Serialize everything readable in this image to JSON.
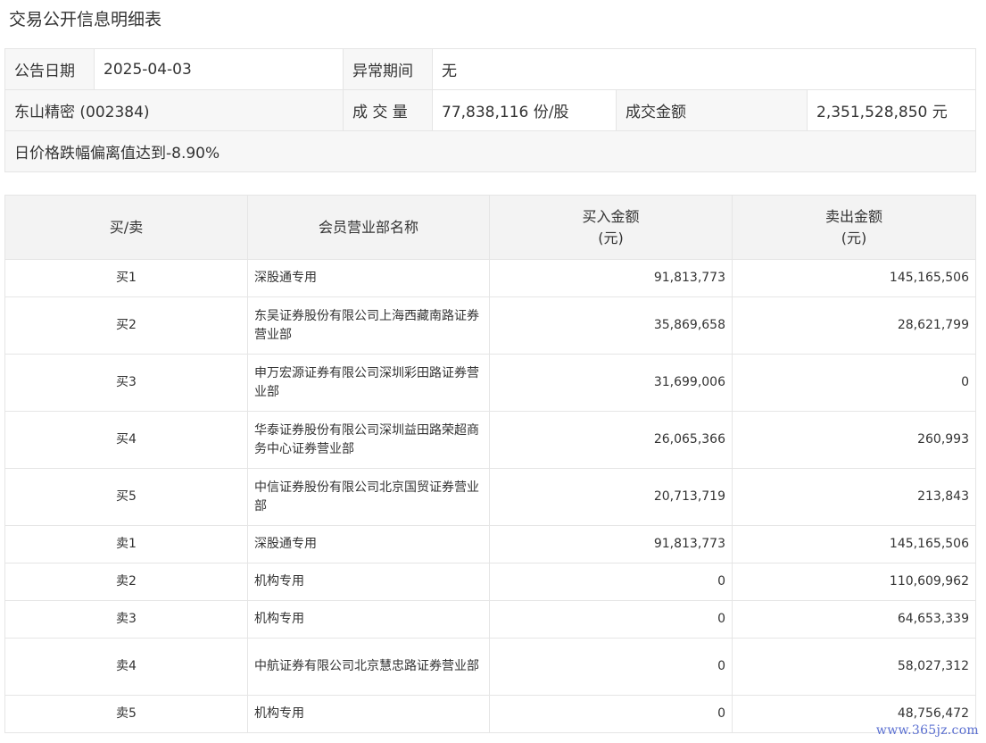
{
  "title": "交易公开信息明细表",
  "info": {
    "date_label": "公告日期",
    "date_value": "2025-04-03",
    "period_label": "异常期间",
    "period_value": "无",
    "stock": "东山精密 (002384)",
    "volume_label": "成 交 量",
    "volume_value": "77,838,116 份/股",
    "amount_label": "成交金额",
    "amount_value": "2,351,528,850 元",
    "note": "日价格跌幅偏离值达到-8.90%"
  },
  "table": {
    "headers": {
      "side": "买/卖",
      "broker": "会员营业部名称",
      "buy_line1": "买入金额",
      "buy_line2": "(元)",
      "sell_line1": "卖出金额",
      "sell_line2": "(元)"
    },
    "rows": [
      {
        "side": "买1",
        "broker": "深股通专用",
        "buy": "91,813,773",
        "sell": "145,165,506"
      },
      {
        "side": "买2",
        "broker": "东吴证券股份有限公司上海西藏南路证券营业部",
        "buy": "35,869,658",
        "sell": "28,621,799"
      },
      {
        "side": "买3",
        "broker": "申万宏源证券有限公司深圳彩田路证券营业部",
        "buy": "31,699,006",
        "sell": "0"
      },
      {
        "side": "买4",
        "broker": "华泰证券股份有限公司深圳益田路荣超商务中心证券营业部",
        "buy": "26,065,366",
        "sell": "260,993"
      },
      {
        "side": "买5",
        "broker": "中信证券股份有限公司北京国贸证券营业部",
        "buy": "20,713,719",
        "sell": "213,843"
      },
      {
        "side": "卖1",
        "broker": "深股通专用",
        "buy": "91,813,773",
        "sell": "145,165,506"
      },
      {
        "side": "卖2",
        "broker": "机构专用",
        "buy": "0",
        "sell": "110,609,962"
      },
      {
        "side": "卖3",
        "broker": "机构专用",
        "buy": "0",
        "sell": "64,653,339"
      },
      {
        "side": "卖4",
        "broker": "中航证券有限公司北京慧忠路证券营业部",
        "buy": "0",
        "sell": "58,027,312"
      },
      {
        "side": "卖5",
        "broker": "机构专用",
        "buy": "0",
        "sell": "48,756,472"
      }
    ]
  },
  "watermark": "www.365jz.com"
}
